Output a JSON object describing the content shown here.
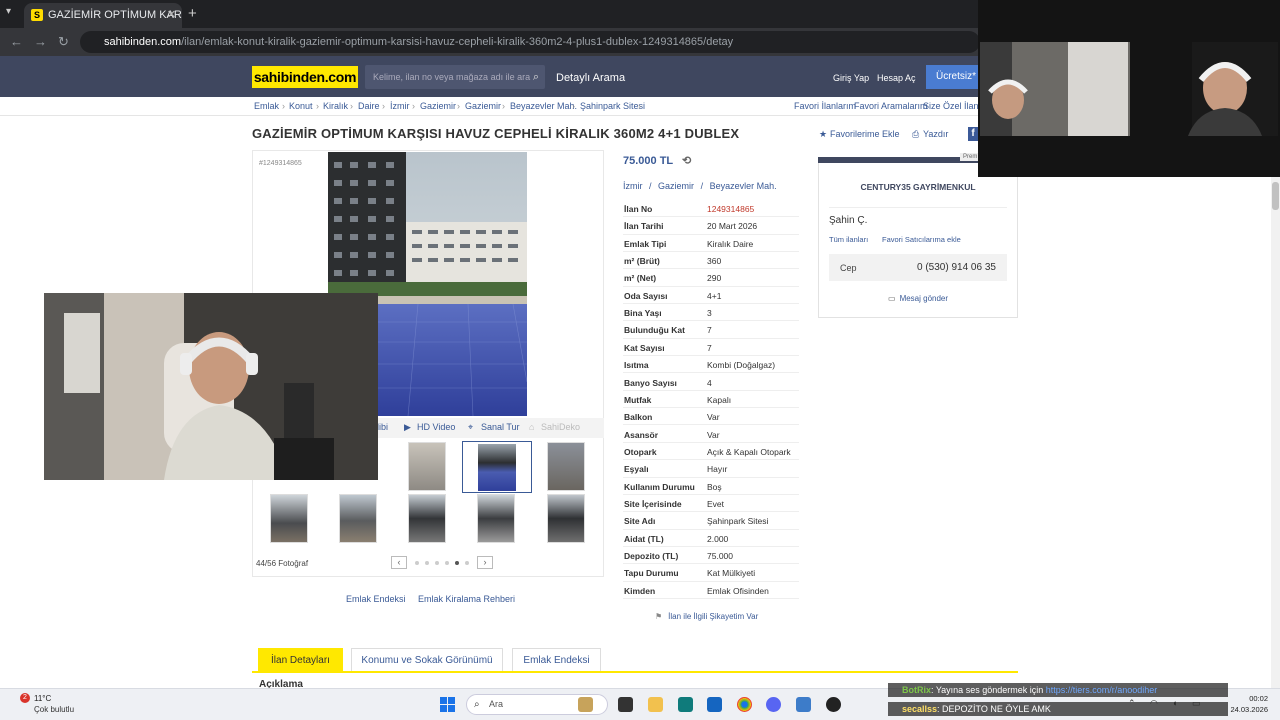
{
  "browser": {
    "tab_title": "GAZİEMİR OPTİMUM KARŞISI H",
    "favicon_letter": "S",
    "url_host": "sahibinden.com",
    "url_path": "/ilan/emlak-konut-kiralik-gaziemir-optimum-karsisi-havuz-cepheli-kiralik-360m2-4-plus1-dublex-1249314865/detay"
  },
  "header": {
    "logo": "sahibinden.com",
    "search_placeholder": "Kelime, ilan no veya mağaza adı ile ara",
    "detailed_search": "Detaylı Arama",
    "login": "Giriş Yap",
    "register": "Hesap Aç",
    "free_ad": "Ücretsiz* İ"
  },
  "breadcrumbs": [
    "Emlak",
    "Konut",
    "Kiralık",
    "Daire",
    "İzmir",
    "Gaziemir",
    "Gaziemir",
    "Beyazevler Mah.",
    "Şahinpark Sitesi"
  ],
  "breadcrumb_links": {
    "fav_listings": "Favori İlanlarım",
    "fav_searches": "Favori Aramalarım",
    "special": "Size Özel İlanlar"
  },
  "title_actions": {
    "add_fav": "Favorilerime Ekle",
    "print": "Yazdır",
    "facebook": "f"
  },
  "listing": {
    "title": "GAZİEMİR OPTİMUM KARŞISI HAVUZ CEPHELİ KİRALIK 360M2 4+1 DUBLEX",
    "number_tag": "#1249314865",
    "price": "75.000 TL",
    "location": [
      "İzmir",
      "Gaziemir",
      "Beyazevler Mah."
    ],
    "location_sep": "/"
  },
  "gallery": {
    "tools": [
      "libi",
      "HD Video",
      "Sanal Tur",
      "SahiDeko"
    ],
    "photo_count": "44/56 Fotoğraf",
    "links": [
      "Emlak Endeksi",
      "Emlak Kiralama Rehberi"
    ]
  },
  "details": [
    {
      "k": "İlan No",
      "v": "1249314865"
    },
    {
      "k": "İlan Tarihi",
      "v": "20 Mart 2026"
    },
    {
      "k": "Emlak Tipi",
      "v": "Kiralık Daire"
    },
    {
      "k": "m² (Brüt)",
      "v": "360"
    },
    {
      "k": "m² (Net)",
      "v": "290"
    },
    {
      "k": "Oda Sayısı",
      "v": "4+1"
    },
    {
      "k": "Bina Yaşı",
      "v": "3"
    },
    {
      "k": "Bulunduğu Kat",
      "v": "7"
    },
    {
      "k": "Kat Sayısı",
      "v": "7"
    },
    {
      "k": "Isıtma",
      "v": "Kombi (Doğalgaz)"
    },
    {
      "k": "Banyo Sayısı",
      "v": "4"
    },
    {
      "k": "Mutfak",
      "v": "Kapalı"
    },
    {
      "k": "Balkon",
      "v": "Var"
    },
    {
      "k": "Asansör",
      "v": "Var"
    },
    {
      "k": "Otopark",
      "v": "Açık & Kapalı Otopark"
    },
    {
      "k": "Eşyalı",
      "v": "Hayır"
    },
    {
      "k": "Kullanım Durumu",
      "v": "Boş"
    },
    {
      "k": "Site İçerisinde",
      "v": "Evet"
    },
    {
      "k": "Site Adı",
      "v": "Şahinpark Sitesi"
    },
    {
      "k": "Aidat (TL)",
      "v": "2.000"
    },
    {
      "k": "Depozito (TL)",
      "v": "75.000"
    },
    {
      "k": "Tapu Durumu",
      "v": "Kat Mülkiyeti"
    },
    {
      "k": "Kimden",
      "v": "Emlak Ofisinden"
    }
  ],
  "complaint": "İlan ile İlgili Şikayetim Var",
  "seller": {
    "agency": "CENTURY35 GAYRİMENKUL",
    "agent": "Şahin Ç.",
    "all_listings": "Tüm ilanları",
    "add_fav_seller": "Favori Satıcılarıma ekle",
    "phone_label": "Cep",
    "phone": "0 (530) 914 06 35",
    "message": "Mesaj gönder",
    "premium": "Prem"
  },
  "bottom_tabs": [
    "İlan Detayları",
    "Konumu ve Sokak Görünümü",
    "Emlak Endeksi"
  ],
  "description_heading": "Açıklama",
  "taskbar": {
    "weather_temp": "11°C",
    "weather_desc": "Çok bulutlu",
    "weather_badge": "2",
    "search": "Ara",
    "time": "00:02",
    "date": "24.03.2026"
  },
  "chat": [
    {
      "user": "BotRix",
      "text": ": Yayına ses göndermek için ",
      "link": "https://tiers.com/r/anoodiher"
    },
    {
      "user": "secallss",
      "text": ": DEPOZİTO NE ÖYLE AMK",
      "link": ""
    }
  ],
  "colors": {
    "header_bg": "#3f475f",
    "logo_yellow": "#ffe800",
    "link_blue": "#3a5a96",
    "listing_no_red": "#c0392b"
  }
}
